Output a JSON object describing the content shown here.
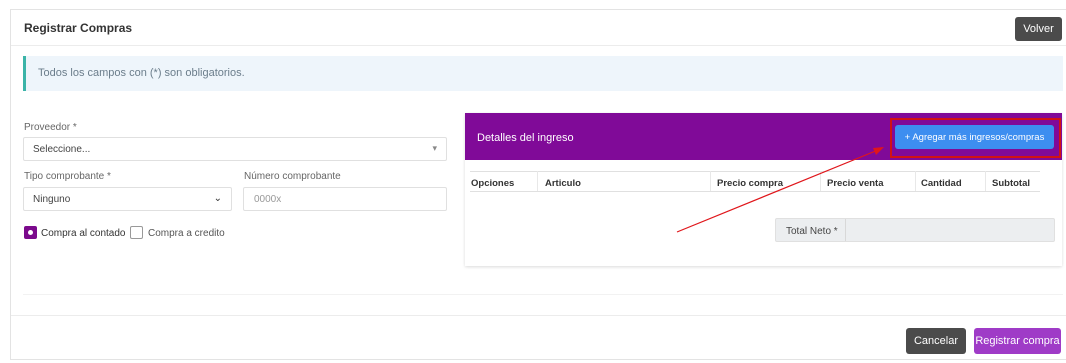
{
  "header": {
    "title": "Registrar Compras",
    "back_label": "Volver"
  },
  "alert": {
    "text": "Todos los campos con (*) son obligatorios."
  },
  "form": {
    "proveedor_label": "Proveedor *",
    "proveedor_value": "Seleccione...",
    "tipo_label": "Tipo comprobante *",
    "tipo_value": "Ninguno",
    "numero_label": "Número comprobante",
    "numero_placeholder": "0000x",
    "contado_label": "Compra al contado",
    "credito_label": "Compra a credito",
    "contado_checked": true,
    "credito_checked": false
  },
  "details": {
    "title": "Detalles del ingreso",
    "add_button": "+ Agregar más ingresos/compras",
    "columns": [
      "Opciones",
      "Articulo",
      "Precio compra",
      "Precio venta",
      "Cantidad",
      "Subtotal"
    ],
    "total_label": "Total Neto *"
  },
  "footer": {
    "cancel_label": "Cancelar",
    "submit_label": "Registrar compra"
  },
  "colors": {
    "detail_header": "#800a98",
    "add_button": "#3d8ef0",
    "submit": "#9f3bc7",
    "annotation": "#d11313"
  },
  "icons": {
    "select_caret": "chevron-down-icon",
    "arrow": "annotation-arrow"
  }
}
